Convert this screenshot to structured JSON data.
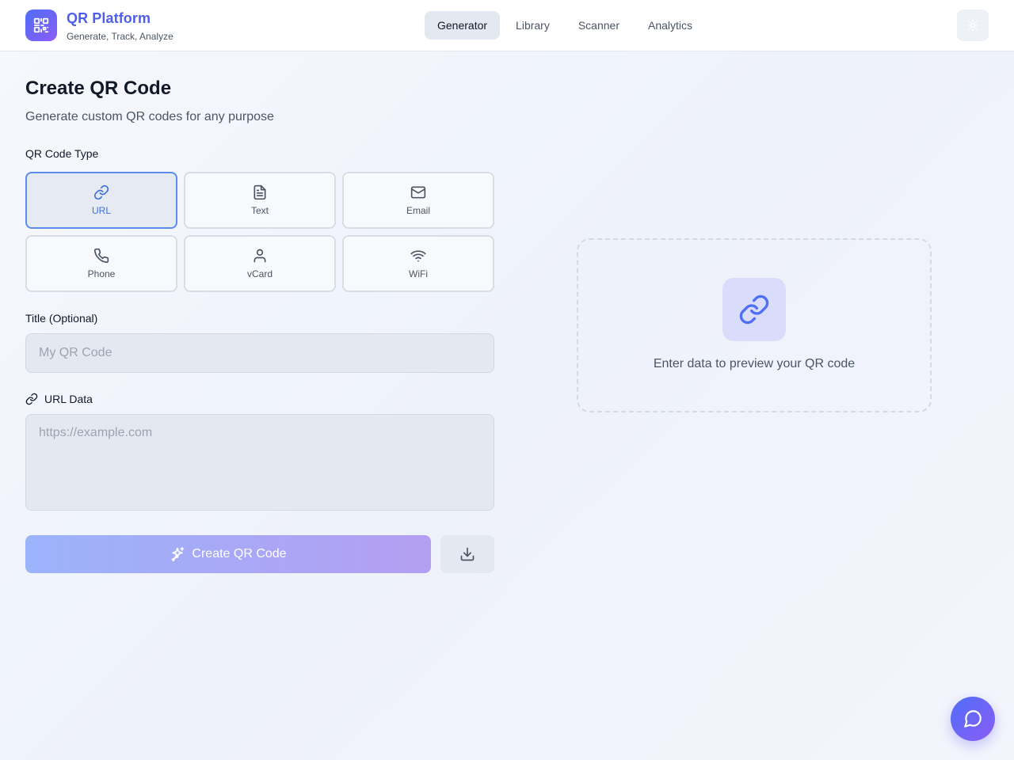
{
  "header": {
    "brand_title": "QR Platform",
    "brand_subtitle": "Generate, Track, Analyze",
    "logo_icon": "qr-code-icon",
    "nav": [
      {
        "label": "Generator",
        "active": true
      },
      {
        "label": "Library",
        "active": false
      },
      {
        "label": "Scanner",
        "active": false
      },
      {
        "label": "Analytics",
        "active": false
      }
    ],
    "theme_icon": "sun-icon"
  },
  "main": {
    "title": "Create QR Code",
    "subtitle": "Generate custom QR codes for any purpose",
    "type_label": "QR Code Type",
    "types": [
      {
        "label": "URL",
        "icon": "link-icon",
        "selected": true
      },
      {
        "label": "Text",
        "icon": "file-text-icon",
        "selected": false
      },
      {
        "label": "Email",
        "icon": "mail-icon",
        "selected": false
      },
      {
        "label": "Phone",
        "icon": "phone-icon",
        "selected": false
      },
      {
        "label": "vCard",
        "icon": "user-icon",
        "selected": false
      },
      {
        "label": "WiFi",
        "icon": "wifi-icon",
        "selected": false
      }
    ],
    "title_field": {
      "label": "Title (Optional)",
      "placeholder": "My QR Code",
      "value": ""
    },
    "data_field": {
      "label": "URL Data",
      "placeholder": "https://example.com",
      "value": ""
    },
    "create_button": "Create QR Code",
    "download_icon": "download-icon"
  },
  "preview": {
    "icon": "link-icon",
    "message": "Enter data to preview your QR code"
  },
  "chat_icon": "message-circle-icon",
  "colors": {
    "accent": "#4f6ef7",
    "accent_secondary": "#8b5cf6",
    "selected_border": "#5b8def"
  }
}
